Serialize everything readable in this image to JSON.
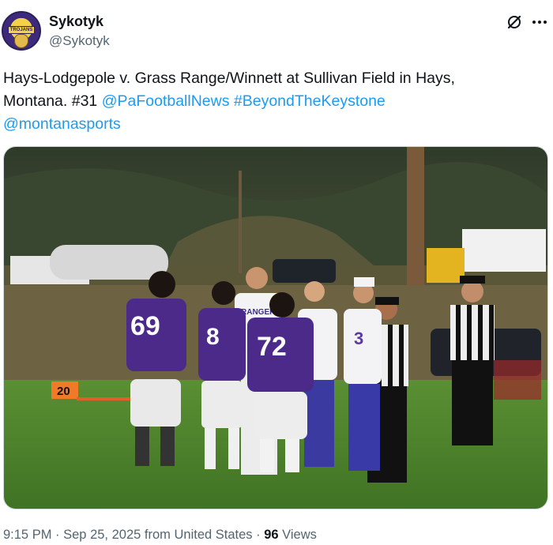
{
  "author": {
    "display_name": "Sykotyk",
    "handle": "@Sykotyk",
    "avatar_badge": "TROJANS"
  },
  "icons": {
    "grok": "grok-slash-icon",
    "more": "more-dots-icon"
  },
  "tweet": {
    "text_line1": "Hays-Lodgepole v. Grass Range/Winnett at Sullivan Field in Hays,",
    "text_line2_plain": "Montana. #31 ",
    "mention1": "@PaFootballNews",
    "hashtag": "#BeyondTheKeystone",
    "mention2": "@montanasports"
  },
  "photo": {
    "jerseys": [
      "69",
      "8",
      "72",
      "3"
    ],
    "team_text": "RANGERS",
    "marker": "20"
  },
  "meta": {
    "time": "9:15 PM",
    "date": "Sep 25, 2025",
    "location": "from United States",
    "views_count": "96",
    "views_label": "Views"
  },
  "colors": {
    "link": "#1d9bf0",
    "secondary_text": "#536471",
    "purple_jersey": "#4b2a8a",
    "grass": "#4f8a2c"
  }
}
